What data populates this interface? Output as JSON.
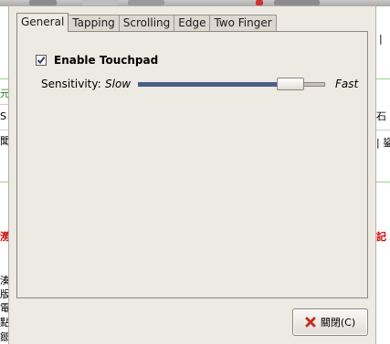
{
  "tabs": [
    {
      "label": "General",
      "active": true
    },
    {
      "label": "Tapping",
      "active": false
    },
    {
      "label": "Scrolling",
      "active": false
    },
    {
      "label": "Edge",
      "active": false
    },
    {
      "label": "Two Finger",
      "active": false
    }
  ],
  "general": {
    "enable_label": "Enable Touchpad",
    "enable_checked": true,
    "sensitivity_label": "Sensitivity:",
    "slow_label": "Slow",
    "fast_label": "Fast",
    "sensitivity_value": 0.87
  },
  "close_button": {
    "label": "關閉(C)",
    "icon": "close-x-icon",
    "icon_color": "#c03020"
  },
  "background_page": {
    "left_fragments": [
      "元",
      "S",
      "聞",
      "澇",
      "湊",
      "版",
      "電",
      "點",
      "鄒"
    ],
    "right_fragments": [
      "|",
      "石",
      "| 鋆",
      "記"
    ]
  },
  "colors": {
    "accent": "#4b5f86",
    "dialog_bg": "#ede9e3"
  }
}
